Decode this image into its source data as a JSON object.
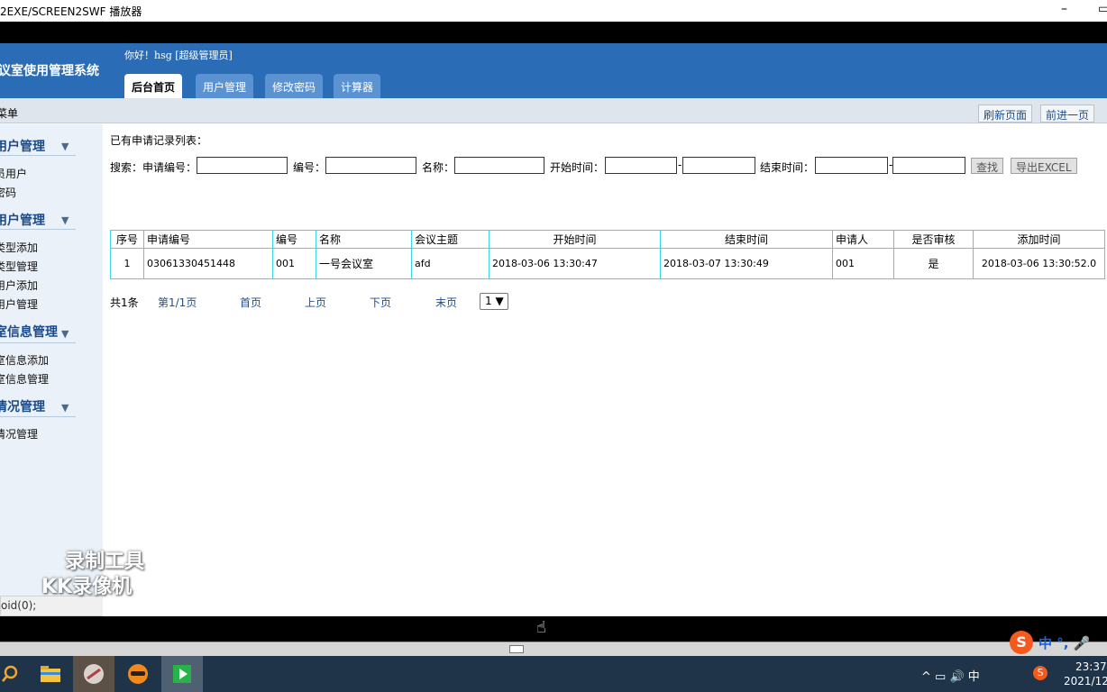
{
  "window": {
    "title": "2EXE/SCREEN2SWF 播放器",
    "minimize": "–",
    "restore": "▭"
  },
  "header": {
    "system_title": "议室使用管理系统",
    "greeting": "你好！hsg [超级管理员]",
    "tabs": [
      {
        "label": "后台首页",
        "active": true
      },
      {
        "label": "用户管理",
        "active": false
      },
      {
        "label": "修改密码",
        "active": false
      },
      {
        "label": "计算器",
        "active": false
      }
    ]
  },
  "subbar": {
    "menu_label": "菜单",
    "refresh": "刷新页面",
    "forward": "前进一页"
  },
  "sidebar": {
    "groups": [
      {
        "title": "用户管理",
        "items": [
          "员用户",
          "密码"
        ]
      },
      {
        "title": "用户管理",
        "items": [
          "类型添加",
          "类型管理",
          "用户添加",
          "用户管理"
        ]
      },
      {
        "title": "室信息管理",
        "items": [
          "室信息添加",
          "室信息管理"
        ]
      },
      {
        "title": "情况管理",
        "items": [
          "情况管理"
        ]
      }
    ],
    "status_text": "oid(0);"
  },
  "main": {
    "list_title": "已有申请记录列表：",
    "search": {
      "label": "搜索：",
      "apply_no": "申请编号：",
      "number": "编号：",
      "name": "名称：",
      "start_time": "开始时间：",
      "end_time": "结束时间：",
      "find": "查找",
      "export": "导出EXCEL"
    },
    "table": {
      "headers": [
        "序号",
        "申请编号",
        "编号",
        "名称",
        "会议主题",
        "开始时间",
        "结束时间",
        "申请人",
        "是否审核",
        "添加时间"
      ],
      "rows": [
        [
          "1",
          "03061330451448",
          "001",
          "一号会议室",
          "afd",
          "2018-03-06 13:30:47",
          "2018-03-07 13:30:49",
          "001",
          "是",
          "2018-03-06 13:30:52.0"
        ]
      ]
    },
    "pager": {
      "total": "共1条",
      "page": "第1/1页",
      "first": "首页",
      "prev": "上页",
      "next": "下页",
      "last": "末页",
      "select": "1"
    }
  },
  "watermark": {
    "line1": "录制工具",
    "line2": "KK录像机"
  },
  "ime": {
    "logo": "S",
    "text": "中 °, 🎤"
  },
  "taskbar": {
    "tray_text": "^ ▭ 🔊 中",
    "time": "23:37",
    "date": "2021/12"
  },
  "colors": {
    "header_blue": "#2a6db6",
    "table_border": "#3fd4e4",
    "taskbar": "#1f3349"
  }
}
